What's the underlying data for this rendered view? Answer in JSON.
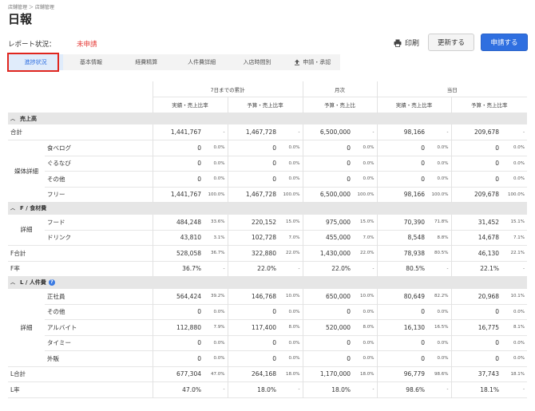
{
  "breadcrumb": "店舗管理 ＞ 店舗管理",
  "title": "日報",
  "status": {
    "label": "レポート状況：",
    "value": "未申請"
  },
  "actions": {
    "print": "印刷",
    "update": "更新する",
    "apply": "申請する"
  },
  "tabs": [
    "進捗状況",
    "基本情報",
    "経費精算",
    "人件費詳細",
    "入店時間別",
    "申請・承認"
  ],
  "header": {
    "groups": [
      "7日までの累計",
      "月次",
      "当日"
    ],
    "subs": [
      "実績・売上比率",
      "予算・売上比率",
      "予算・売上比",
      "実績・売上比率",
      "予算・売上比率"
    ]
  },
  "sections": {
    "sales": "売上高",
    "food": "F / 食材費",
    "labor": "L / 人件費",
    "help": "?"
  },
  "groups": {
    "media": "媒体詳細",
    "detail_f": "詳細",
    "detail_l": "詳細"
  },
  "rows": {
    "sales_total": [
      "合計",
      "1,441,767",
      "-",
      "1,467,728",
      "-",
      "6,500,000",
      "-",
      "98,166",
      "-",
      "209,678",
      "-"
    ],
    "tabelog": [
      "食べログ",
      "0",
      "0.0%",
      "0",
      "0.0%",
      "0",
      "0.0%",
      "0",
      "0.0%",
      "0",
      "0.0%"
    ],
    "gurunavi": [
      "ぐるなび",
      "0",
      "0.0%",
      "0",
      "0.0%",
      "0",
      "0.0%",
      "0",
      "0.0%",
      "0",
      "0.0%"
    ],
    "other_media": [
      "その他",
      "0",
      "0.0%",
      "0",
      "0.0%",
      "0",
      "0.0%",
      "0",
      "0.0%",
      "0",
      "0.0%"
    ],
    "free": [
      "フリー",
      "1,441,767",
      "100.0%",
      "1,467,728",
      "100.0%",
      "6,500,000",
      "100.0%",
      "98,166",
      "100.0%",
      "209,678",
      "100.0%"
    ],
    "food": [
      "フード",
      "484,248",
      "33.6%",
      "220,152",
      "15.0%",
      "975,000",
      "15.0%",
      "70,390",
      "71.8%",
      "31,452",
      "15.1%"
    ],
    "drink": [
      "ドリンク",
      "43,810",
      "3.1%",
      "102,728",
      "7.0%",
      "455,000",
      "7.0%",
      "8,548",
      "8.8%",
      "14,678",
      "7.1%"
    ],
    "f_total": [
      "F合計",
      "528,058",
      "36.7%",
      "322,880",
      "22.0%",
      "1,430,000",
      "22.0%",
      "78,938",
      "80.5%",
      "46,130",
      "22.1%"
    ],
    "f_rate": [
      "F率",
      "36.7%",
      "-",
      "22.0%",
      "-",
      "22.0%",
      "-",
      "80.5%",
      "-",
      "22.1%",
      "-"
    ],
    "regular": [
      "正社員",
      "564,424",
      "39.2%",
      "146,768",
      "10.0%",
      "650,000",
      "10.0%",
      "80,649",
      "82.2%",
      "20,968",
      "10.1%"
    ],
    "other_staff": [
      "その他",
      "0",
      "0.0%",
      "0",
      "0.0%",
      "0",
      "0.0%",
      "0",
      "0.0%",
      "0",
      "0.0%"
    ],
    "part_time": [
      "アルバイト",
      "112,880",
      "7.9%",
      "117,400",
      "8.0%",
      "520,000",
      "8.0%",
      "16,130",
      "16.5%",
      "16,775",
      "8.1%"
    ],
    "timee": [
      "タイミー",
      "0",
      "0.0%",
      "0",
      "0.0%",
      "0",
      "0.0%",
      "0",
      "0.0%",
      "0",
      "0.0%"
    ],
    "outsource": [
      "外販",
      "0",
      "0.0%",
      "0",
      "0.0%",
      "0",
      "0.0%",
      "0",
      "0.0%",
      "0",
      "0.0%"
    ],
    "l_total": [
      "L合計",
      "677,304",
      "47.0%",
      "264,168",
      "18.0%",
      "1,170,000",
      "18.0%",
      "96,779",
      "98.6%",
      "37,743",
      "18.1%"
    ],
    "l_rate": [
      "L率",
      "47.0%",
      "-",
      "18.0%",
      "-",
      "18.0%",
      "-",
      "98.6%",
      "-",
      "18.1%",
      "-"
    ]
  },
  "colors": {
    "accent": "#2f6fe0",
    "alert": "#e53935",
    "highlight": "#e0261f"
  }
}
